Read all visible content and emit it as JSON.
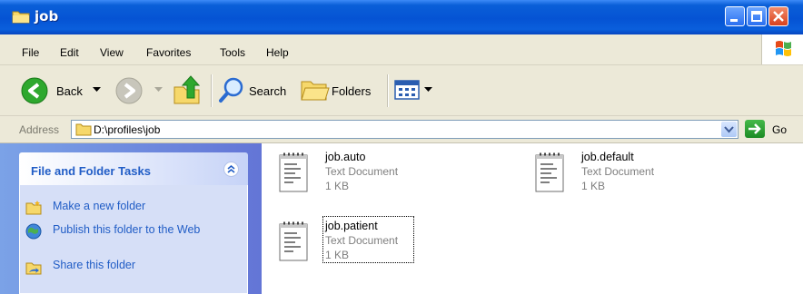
{
  "window": {
    "title": "job"
  },
  "menu": [
    "File",
    "Edit",
    "View",
    "Favorites",
    "Tools",
    "Help"
  ],
  "toolbar": {
    "back": "Back",
    "search": "Search",
    "folders": "Folders"
  },
  "address": {
    "label": "Address",
    "path": "D:\\profiles\\job",
    "go": "Go"
  },
  "tasks": {
    "title": "File and Folder Tasks",
    "items": [
      {
        "label": "Make a new folder",
        "icon": "new-folder-icon"
      },
      {
        "label": "Publish this folder to the Web",
        "icon": "publish-web-icon"
      },
      {
        "label": "Share this folder",
        "icon": "share-folder-icon"
      }
    ]
  },
  "files": [
    {
      "name": "job.auto",
      "type": "Text Document",
      "size": "1 KB"
    },
    {
      "name": "job.default",
      "type": "Text Document",
      "size": "1 KB"
    },
    {
      "name": "job.patient",
      "type": "Text Document",
      "size": "1 KB"
    }
  ],
  "colors": {
    "titlebar": "#0553d4",
    "taskpane": "#7ba2e7",
    "link": "#215dc6"
  }
}
